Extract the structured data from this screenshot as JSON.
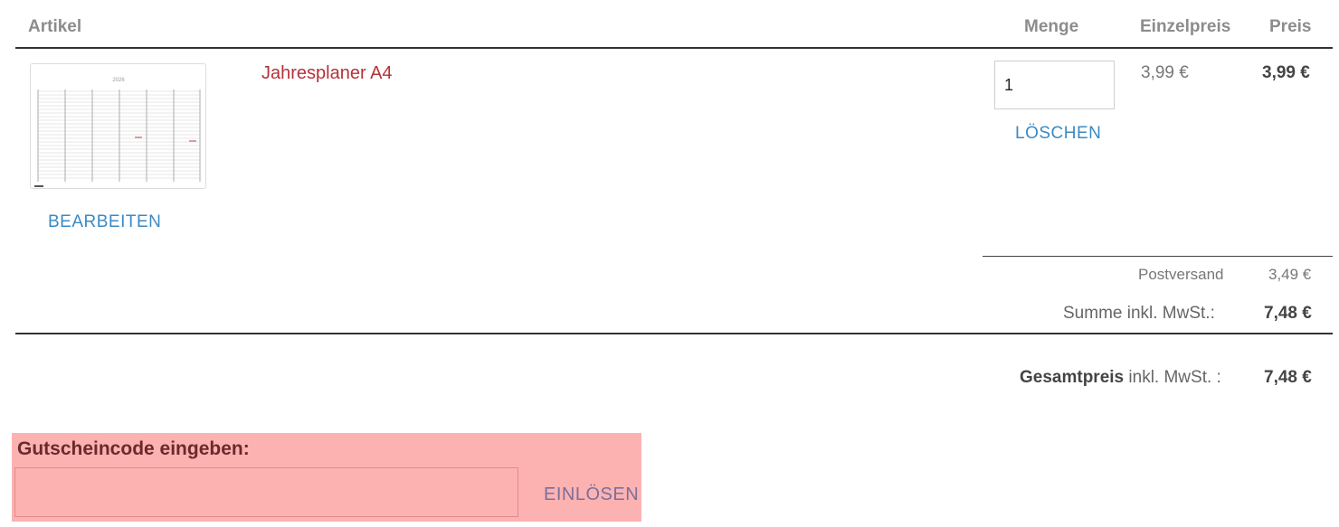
{
  "table_header": {
    "article": "Artikel",
    "quantity": "Menge",
    "unit_price": "Einzelpreis",
    "price": "Preis"
  },
  "item": {
    "name": "Jahresplaner A4",
    "edit_label": "BEARBEITEN",
    "quantity": "1",
    "delete_label": "LÖSCHEN",
    "unit_price": "3,99 €",
    "price": "3,99 €",
    "thumbnail_year": "2026"
  },
  "summary": {
    "shipping_label": "Postversand",
    "shipping_value": "3,49 €",
    "sum_label": "Summe inkl. MwSt.:",
    "sum_value": "7,48 €"
  },
  "total": {
    "label_bold": "Gesamtpreis",
    "label_rest": " inkl. MwSt. :",
    "value": "7,48 €"
  },
  "voucher": {
    "title": "Gutscheincode eingeben:",
    "input_value": "",
    "redeem_label": "EINLÖSEN"
  },
  "colors": {
    "link_blue": "#3b8ac4",
    "item_red": "#b5313a",
    "voucher_bg": "#fdb2b2"
  }
}
